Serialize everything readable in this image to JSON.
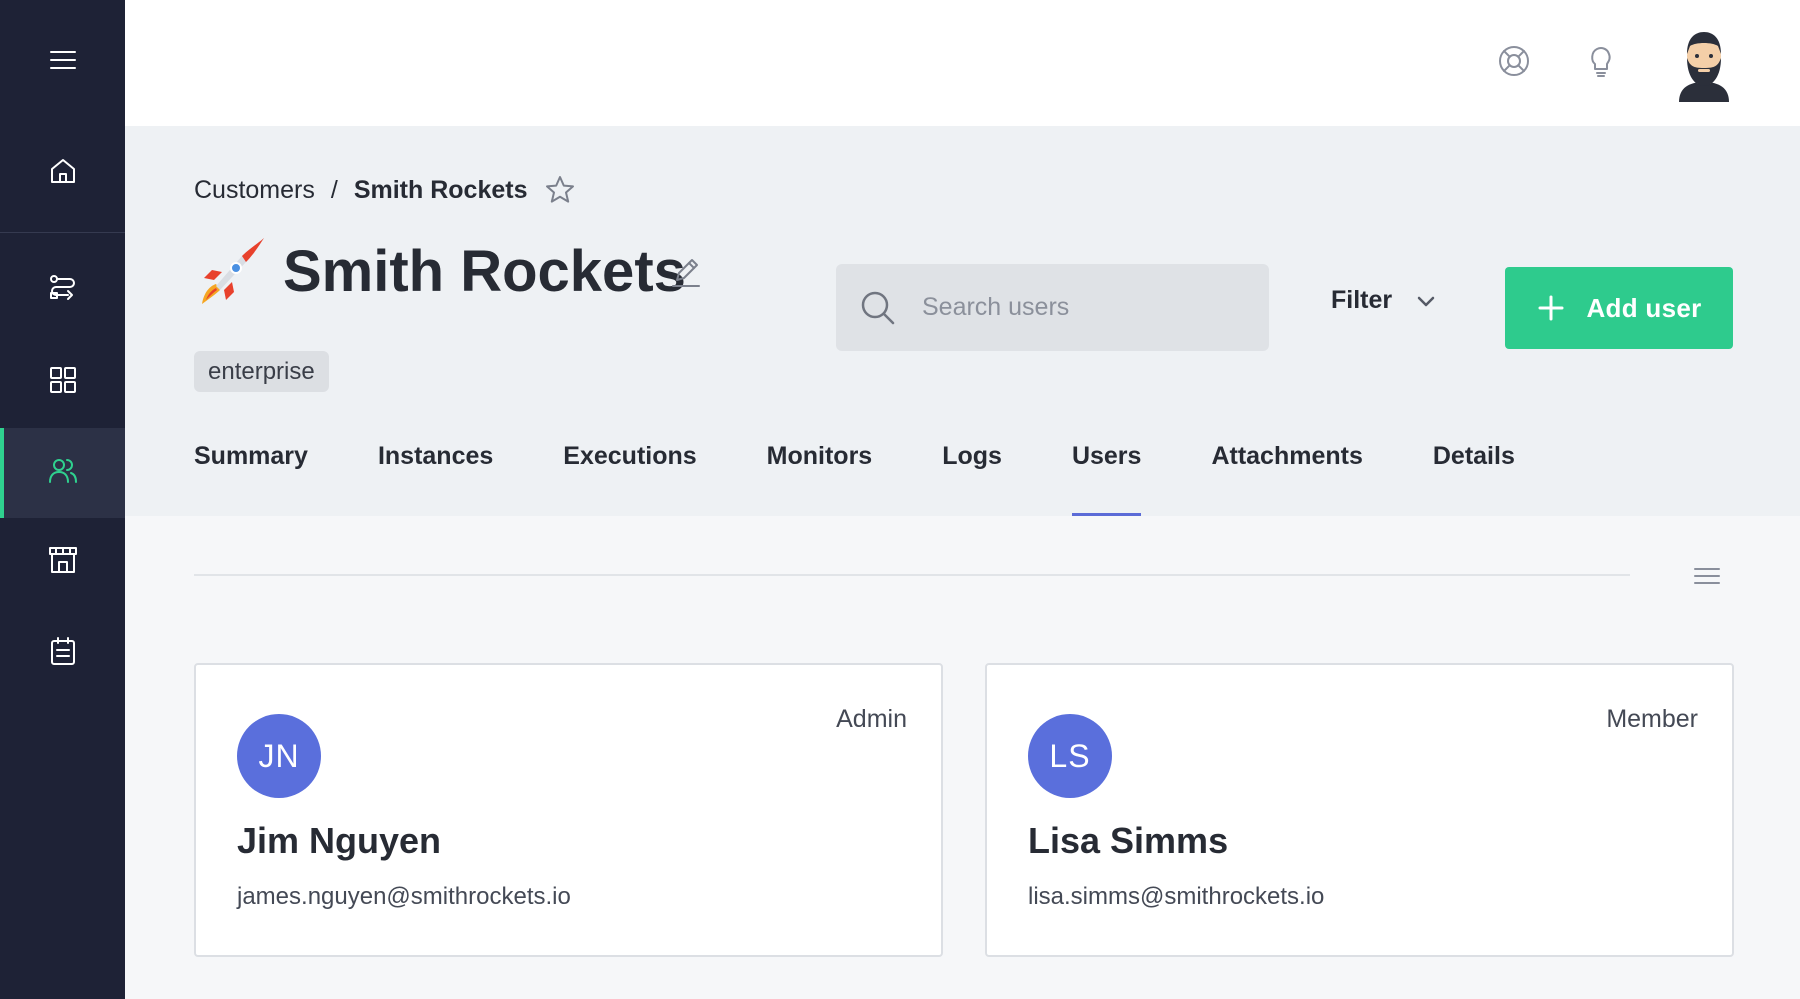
{
  "sidebar": {
    "items": [
      {
        "name": "menu"
      },
      {
        "name": "home"
      },
      {
        "name": "routes"
      },
      {
        "name": "dashboard"
      },
      {
        "name": "customers",
        "active": true
      },
      {
        "name": "store"
      },
      {
        "name": "notes"
      }
    ],
    "accent_color": "#2fd18f"
  },
  "topbar": {
    "icons": [
      "support-icon",
      "lightbulb-icon",
      "user-avatar"
    ]
  },
  "breadcrumb": {
    "parent": "Customers",
    "separator": "/",
    "current": "Smith Rockets"
  },
  "page": {
    "title": "Smith Rockets",
    "tag": "enterprise"
  },
  "search": {
    "placeholder": "Search users",
    "value": ""
  },
  "filter": {
    "label": "Filter"
  },
  "add_button": {
    "label": "Add user",
    "color": "#2ecb8d"
  },
  "tabs": [
    {
      "label": "Summary"
    },
    {
      "label": "Instances"
    },
    {
      "label": "Executions"
    },
    {
      "label": "Monitors"
    },
    {
      "label": "Logs"
    },
    {
      "label": "Users",
      "active": true
    },
    {
      "label": "Attachments"
    },
    {
      "label": "Details"
    }
  ],
  "users": [
    {
      "initials": "JN",
      "name": "Jim Nguyen",
      "email": "james.nguyen@smithrockets.io",
      "role": "Admin"
    },
    {
      "initials": "LS",
      "name": "Lisa Simms",
      "email": "lisa.simms@smithrockets.io",
      "role": "Member"
    }
  ],
  "colors": {
    "tab_underline": "#5b6bd7",
    "avatar_bg": "#5a6fdc"
  }
}
